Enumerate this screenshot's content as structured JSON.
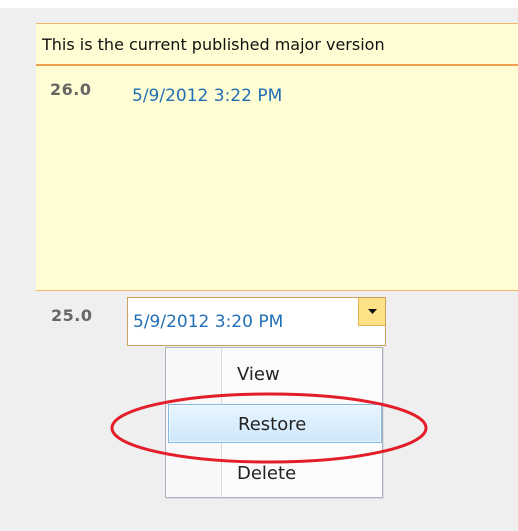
{
  "versions": {
    "current": {
      "header": "This is the current published major version",
      "number": "26.0",
      "date": "5/9/2012 3:22 PM"
    },
    "selected": {
      "number": "25.0",
      "date": "5/9/2012 3:20 PM"
    }
  },
  "context_menu": {
    "items": [
      {
        "label": "View"
      },
      {
        "label": "Restore"
      },
      {
        "label": "Delete"
      }
    ],
    "highlighted_item": "Restore"
  },
  "colors": {
    "page_background": "#efefef",
    "current_background": "#fffdd3",
    "current_border": "#f0a050",
    "link": "#1f6fb6",
    "dropdown_button": "#ffe187",
    "highlight_outline": "#e31d2a",
    "selected_menu_item": "#d7ecfb"
  },
  "icons": {
    "dropdown": "chevron-down-icon",
    "highlight": "red-ellipse-highlight"
  }
}
